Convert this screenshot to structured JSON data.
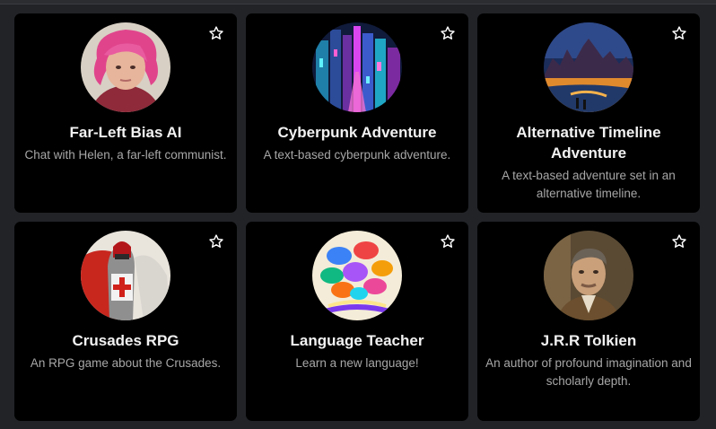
{
  "cards": [
    {
      "title": "Far-Left Bias AI",
      "description": "Chat with Helen, a far-left communist.",
      "avatar": "portrait-pink-hair",
      "favorite_icon": "star-outline-icon"
    },
    {
      "title": "Cyberpunk Adventure",
      "description": "A text-based cyberpunk adventure.",
      "avatar": "neon-city",
      "favorite_icon": "star-outline-icon"
    },
    {
      "title": "Alternative Timeline Adventure",
      "description": "A text-based adventure set in an alternative timeline.",
      "avatar": "sunset-city-river",
      "favorite_icon": "star-outline-icon"
    },
    {
      "title": "Crusades RPG",
      "description": "An RPG game about the Crusades.",
      "avatar": "crusader-knight",
      "favorite_icon": "star-outline-icon"
    },
    {
      "title": "Language Teacher",
      "description": "Learn a new language!",
      "avatar": "speech-bubbles-book",
      "favorite_icon": "star-outline-icon"
    },
    {
      "title": "J.R.R Tolkien",
      "description": "An author of profound imagination and scholarly depth.",
      "avatar": "portrait-tolkien",
      "favorite_icon": "star-outline-icon"
    }
  ]
}
